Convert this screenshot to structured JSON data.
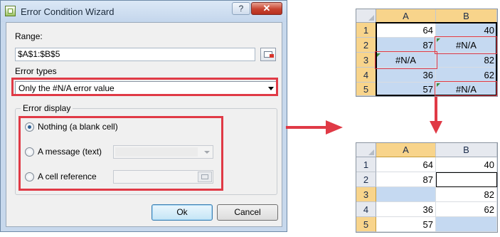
{
  "dialog": {
    "title": "Error Condition Wizard",
    "help_label": "?",
    "close_label": "✕",
    "range_label": "Range:",
    "range_value": "$A$1:$B$5",
    "error_types_label": "Error types",
    "error_type_selected": "Only the #N/A error value",
    "error_display_label": "Error display",
    "options": [
      {
        "label": "Nothing (a blank cell)",
        "selected": true
      },
      {
        "label": "A message (text)",
        "selected": false
      },
      {
        "label": "A cell reference",
        "selected": false
      }
    ],
    "ok_label": "Ok",
    "cancel_label": "Cancel"
  },
  "colors": {
    "highlight": "#e03a46",
    "selection": "#c5d9f1",
    "accent_header": "#f8d48b"
  },
  "sheet_before": {
    "columns": [
      "A",
      "B"
    ],
    "rows": [
      {
        "num": "1",
        "a": "64",
        "b": "40"
      },
      {
        "num": "2",
        "a": "87",
        "b": "#N/A"
      },
      {
        "num": "3",
        "a": "#N/A",
        "b": "82"
      },
      {
        "num": "4",
        "a": "36",
        "b": "62"
      },
      {
        "num": "5",
        "a": "57",
        "b": "#N/A"
      }
    ]
  },
  "sheet_after": {
    "columns": [
      "A",
      "B"
    ],
    "rows": [
      {
        "num": "1",
        "a": "64",
        "b": "40"
      },
      {
        "num": "2",
        "a": "87",
        "b": ""
      },
      {
        "num": "3",
        "a": "",
        "b": "82"
      },
      {
        "num": "4",
        "a": "36",
        "b": "62"
      },
      {
        "num": "5",
        "a": "57",
        "b": ""
      }
    ]
  }
}
